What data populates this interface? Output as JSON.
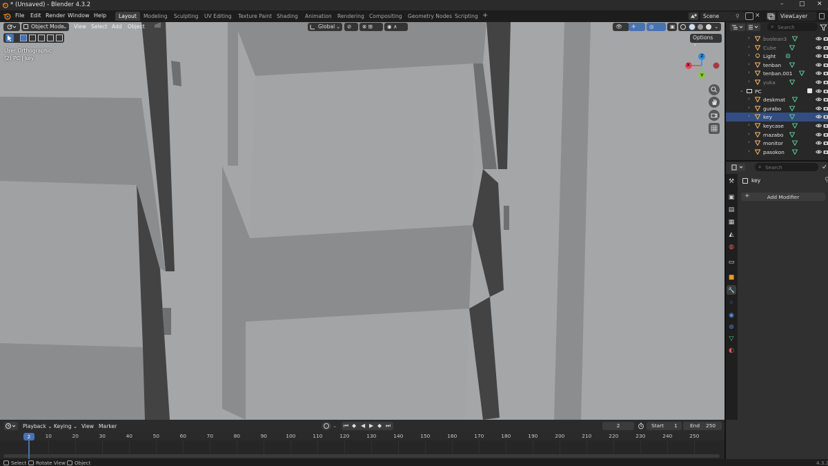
{
  "window": {
    "title": "* (Unsaved) - Blender 4.3.2",
    "controls": [
      "–",
      "□",
      "✕"
    ]
  },
  "menubar": {
    "items": [
      "File",
      "Edit",
      "Render",
      "Window",
      "Help"
    ]
  },
  "workspaces": {
    "tabs": [
      "Layout",
      "Modeling",
      "Sculpting",
      "UV Editing",
      "Texture Paint",
      "Shading",
      "Animation",
      "Rendering",
      "Compositing",
      "Geometry Nodes",
      "Scripting"
    ],
    "active": "Layout",
    "add": "+"
  },
  "scene": {
    "name": "Scene",
    "view_layer": "ViewLayer"
  },
  "viewport": {
    "mode": "Object Mode",
    "menus": [
      "View",
      "Select",
      "Add",
      "Object"
    ],
    "orientation": "Global",
    "options_label": "Options",
    "view_name": "User Orthographic",
    "object_path": "(2) PC | key",
    "gizmo": {
      "x": "X",
      "y": "Y",
      "z": "Z"
    }
  },
  "outliner": {
    "search_placeholder": "Search",
    "rows": [
      {
        "name": "boolean3",
        "icon": "mesh-icon",
        "dim": true
      },
      {
        "name": "Cube",
        "icon": "mesh-icon",
        "dim": true
      },
      {
        "name": "Light",
        "icon": "light-icon",
        "dim": false
      },
      {
        "name": "tenban",
        "icon": "mesh-icon",
        "dim": false
      },
      {
        "name": "tenban.001",
        "icon": "mesh-icon",
        "dim": false
      },
      {
        "name": "yuka",
        "icon": "mesh-icon",
        "dim": true
      },
      {
        "name": "PC",
        "icon": "collection-icon",
        "dim": false,
        "collection": true
      },
      {
        "name": "deskmat",
        "icon": "mesh-icon",
        "dim": false
      },
      {
        "name": "gurabo",
        "icon": "mesh-icon",
        "dim": false
      },
      {
        "name": "key",
        "icon": "mesh-icon",
        "dim": false,
        "selected": true
      },
      {
        "name": "keycase",
        "icon": "mesh-icon",
        "dim": false
      },
      {
        "name": "mazabo",
        "icon": "mesh-icon",
        "dim": false
      },
      {
        "name": "monitor",
        "icon": "mesh-icon",
        "dim": false
      },
      {
        "name": "pasokon",
        "icon": "mesh-icon",
        "dim": false
      }
    ]
  },
  "properties": {
    "search_placeholder": "Search",
    "object_name": "key",
    "add_modifier_label": "Add Modifier",
    "tabs": [
      "tool-icon",
      "render-icon",
      "output-icon",
      "view-layer-icon",
      "scene-icon",
      "world-icon",
      "collection-icon",
      "object-icon",
      "modifier-icon",
      "particles-icon",
      "physics-icon",
      "constraints-icon",
      "data-icon",
      "material-icon"
    ]
  },
  "timeline": {
    "menus": [
      "Playback",
      "Keying",
      "View",
      "Marker"
    ],
    "current_frame": "2",
    "start_label": "Start",
    "start_value": "1",
    "end_label": "End",
    "end_value": "250",
    "ruler_ticks": [
      "2",
      "10",
      "20",
      "30",
      "40",
      "50",
      "60",
      "70",
      "80",
      "90",
      "100",
      "110",
      "120",
      "130",
      "140",
      "150",
      "160",
      "170",
      "180",
      "190",
      "200",
      "210",
      "220",
      "230",
      "240",
      "250"
    ]
  },
  "statusbar": {
    "items": [
      "Select",
      "Rotate View",
      "Object"
    ],
    "version": "4.3.2"
  },
  "colors": {
    "accent": "#4772b3",
    "mesh_icon": "#e0a35a",
    "data_icon": "#55c493",
    "selected_row": "#334d80",
    "gizmo_x": "#e0475b",
    "gizmo_y": "#8ec73e",
    "gizmo_z": "#2e8fe0"
  }
}
